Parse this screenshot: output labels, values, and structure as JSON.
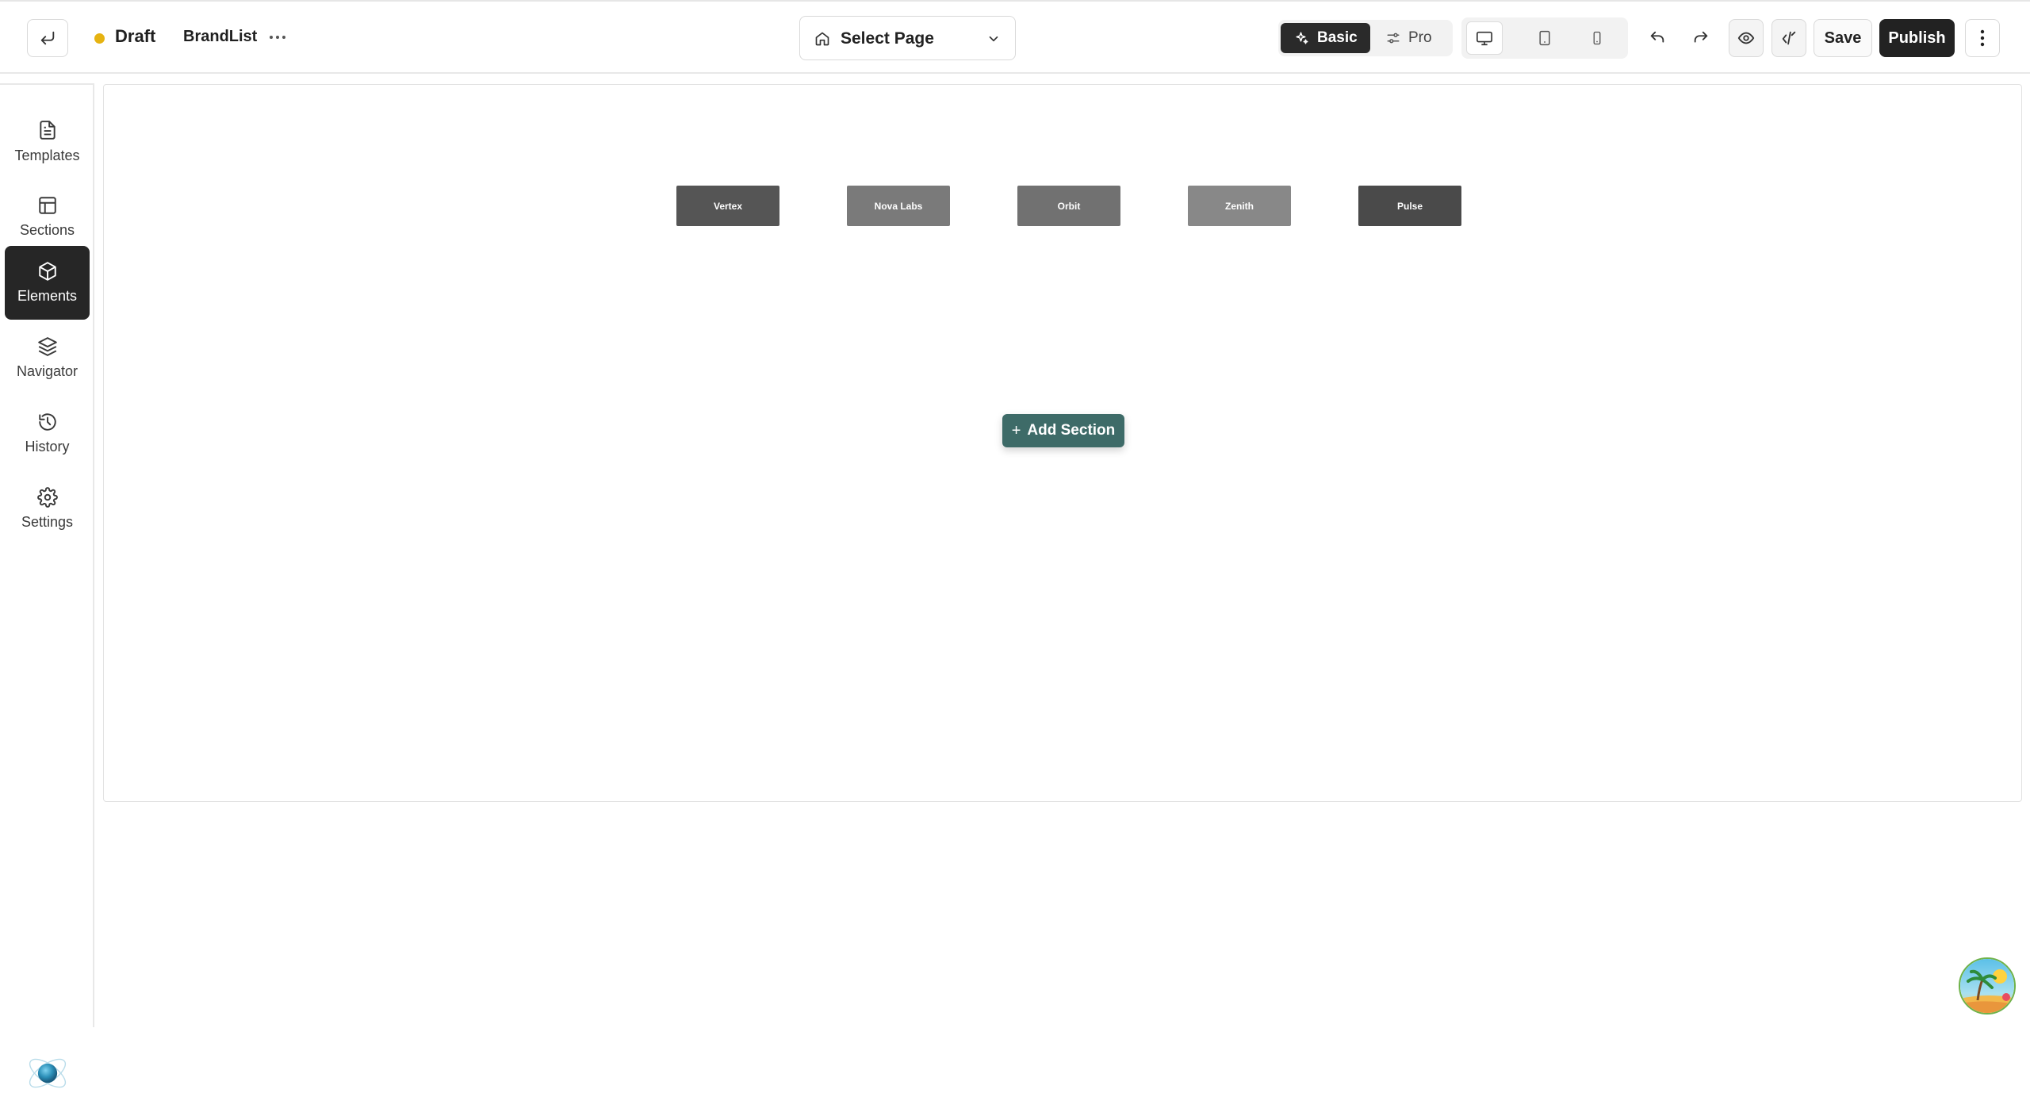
{
  "header": {
    "status": "Draft",
    "page_name": "BrandList",
    "select_page_label": "Select Page",
    "mode_basic": "Basic",
    "mode_pro": "Pro",
    "save_label": "Save",
    "publish_label": "Publish"
  },
  "sidebar": {
    "items": [
      {
        "label": "Templates",
        "icon": "document-icon"
      },
      {
        "label": "Sections",
        "icon": "layout-icon"
      },
      {
        "label": "Elements",
        "icon": "cube-icon",
        "active": true
      },
      {
        "label": "Navigator",
        "icon": "layers-icon"
      },
      {
        "label": "History",
        "icon": "history-icon"
      },
      {
        "label": "Settings",
        "icon": "gear-icon"
      }
    ]
  },
  "canvas": {
    "brands": [
      {
        "name": "Vertex",
        "color": "#555555"
      },
      {
        "name": "Nova Labs",
        "color": "#7a7a7a"
      },
      {
        "name": "Orbit",
        "color": "#717171"
      },
      {
        "name": "Zenith",
        "color": "#888888"
      },
      {
        "name": "Pulse",
        "color": "#4a4a4a"
      }
    ],
    "add_section_label": "Add Section"
  },
  "colors": {
    "accent": "#3e6b68",
    "draft_dot": "#e6b311",
    "dark": "#222222"
  }
}
